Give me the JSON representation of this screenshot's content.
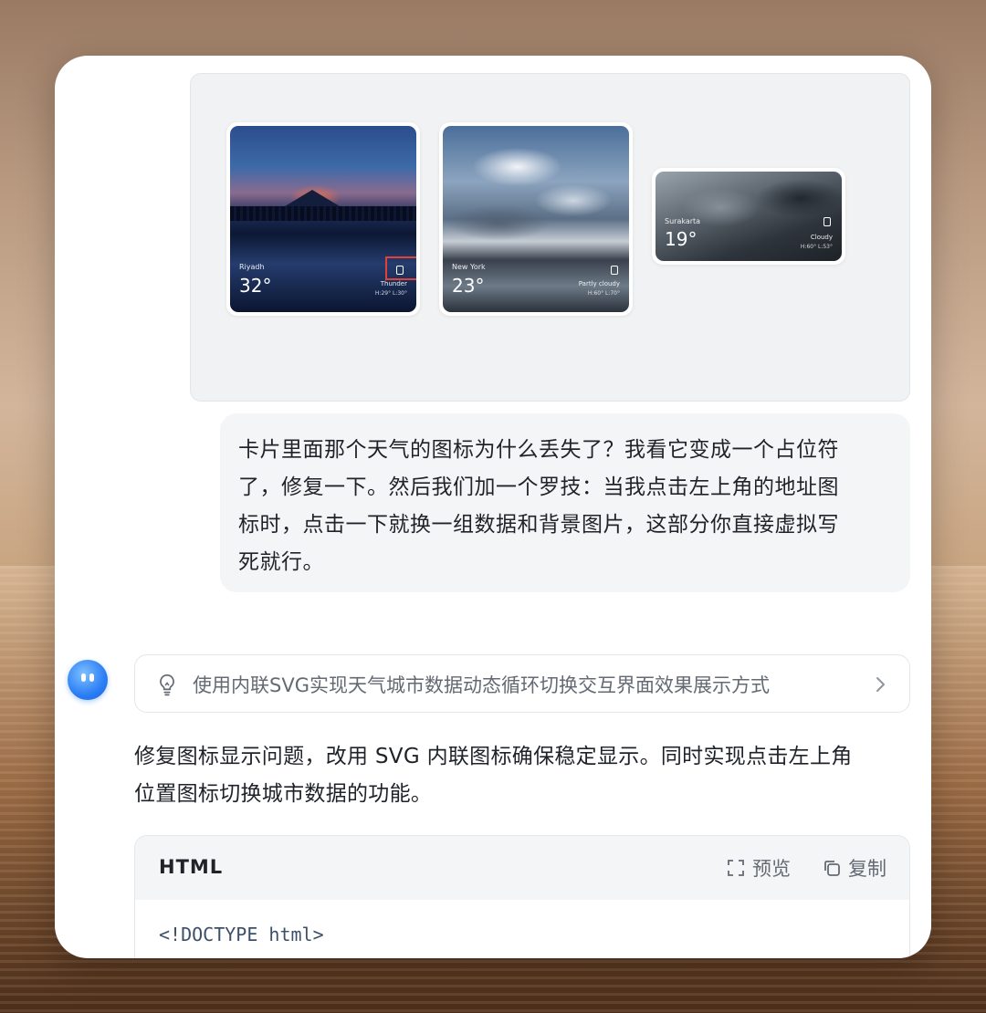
{
  "attachment": {
    "cards": [
      {
        "city": "Riyadh",
        "temp": "32°",
        "condition": "Thunder",
        "hilo": "H:29° L:30°"
      },
      {
        "city": "New York",
        "temp": "23°",
        "condition": "Partly cloudy",
        "hilo": "H:60° L:70°"
      },
      {
        "city": "Surakarta",
        "temp": "19°",
        "condition": "Cloudy",
        "hilo": "H:60° L:53°"
      }
    ]
  },
  "user_message": {
    "lines": [
      "卡片里面那个天气的图标为什么丢失了？我看它变成一个占位符",
      "了，修复一下。然后我们加一个罗技：当我点击左上角的地址图",
      "标时，点击一下就换一组数据和背景图片，这部分你直接虚拟写",
      "死就行。"
    ]
  },
  "assistant": {
    "thought_summary": "使用内联SVG实现天气城市数据动态循环切换交互界面效果展示方式",
    "answer_lines": [
      "修复图标显示问题，改用 SVG 内联图标确保稳定显示。同时实现点击左上角",
      "位置图标切换城市数据的功能。"
    ],
    "code": {
      "language": "HTML",
      "preview_label": "预览",
      "copy_label": "复制",
      "first_line": "<!DOCTYPE html>"
    }
  },
  "colors": {
    "accent": "#2b7ef5",
    "highlight": "#e0413a",
    "bubble_bg": "#f4f5f7"
  }
}
